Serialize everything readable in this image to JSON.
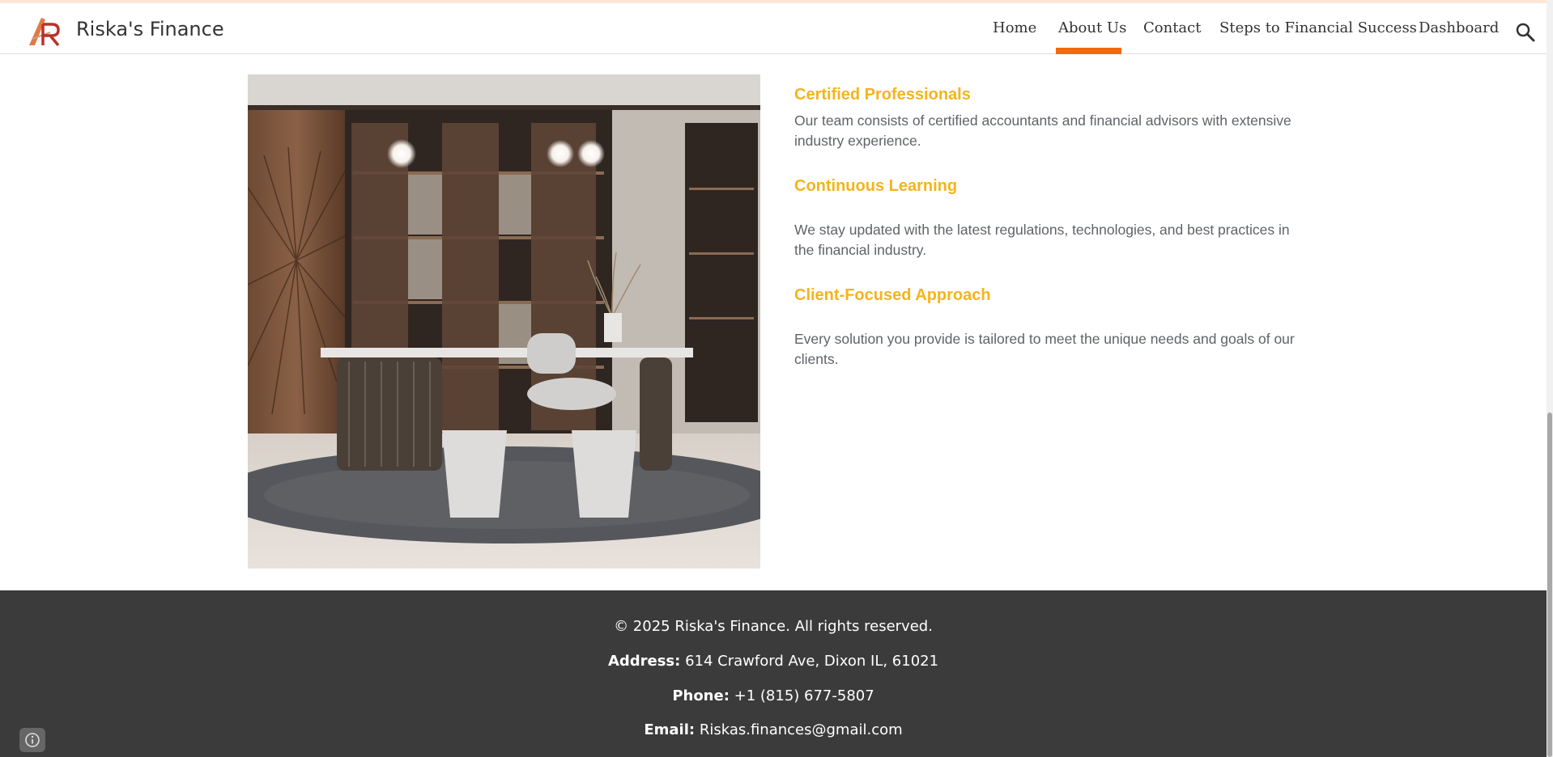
{
  "header": {
    "site_title": "Riska's Finance",
    "nav": [
      {
        "label": "Home"
      },
      {
        "label": "About Us",
        "active": true
      },
      {
        "label": "Contact"
      },
      {
        "label": "Steps to Financial Success"
      },
      {
        "label": "Dashboard"
      }
    ],
    "accent_color": "#f46a0a"
  },
  "features": [
    {
      "title": "Certified Professionals",
      "desc": "Our team consists of certified accountants and financial advisors with extensive industry experience."
    },
    {
      "title": "Continuous Learning",
      "desc": "We stay updated with the latest regulations, technologies, and best practices in the financial industry."
    },
    {
      "title": "Client-Focused Approach",
      "desc": "Every solution you provide is tailored to meet the unique needs and goals of our clients."
    }
  ],
  "footer": {
    "copyright": "© 2025 Riska's Finance. All rights reserved.",
    "address_label": "Address:",
    "address_value": "614 Crawford Ave, Dixon IL, 61021",
    "phone_label": "Phone:",
    "phone_value": "+1 (815) 677-5807",
    "email_label": "Email:",
    "email_value": "Riskas.finances@gmail.com"
  },
  "icons": {
    "logo": "riskas-finance-logo",
    "search": "search-icon",
    "info": "info-icon"
  }
}
